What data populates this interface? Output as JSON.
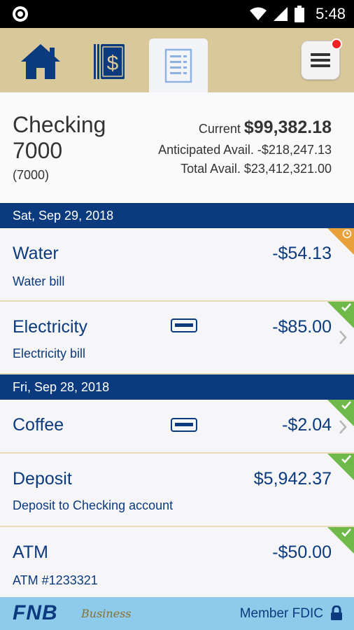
{
  "status_bar": {
    "time": "5:48"
  },
  "nav": {
    "home_icon": "home-icon",
    "accounts_icon": "dollar-cards-icon",
    "register_icon": "register-list-icon",
    "menu_icon": "hamburger-menu-icon"
  },
  "account": {
    "name": "Checking 7000",
    "number": "(7000)",
    "current_label": "Current",
    "current_value": "$99,382.18",
    "anticipated": "Anticipated Avail. -$218,247.13",
    "total": "Total Avail. $23,412,321.00"
  },
  "groups": [
    {
      "date": "Sat, Sep 29, 2018",
      "transactions": [
        {
          "title": "Water",
          "amount": "-$54.13",
          "subtitle": "Water bill",
          "status": "pending"
        },
        {
          "title": "Electricity",
          "amount": "-$85.00",
          "subtitle": "Electricity bill",
          "status": "cleared"
        }
      ]
    },
    {
      "date": "Fri, Sep 28, 2018",
      "transactions": [
        {
          "title": "Coffee",
          "amount": "-$2.04",
          "subtitle": "",
          "status": "cleared"
        },
        {
          "title": "Deposit",
          "amount": "$5,942.37",
          "subtitle": "Deposit to Checking account",
          "status": "cleared"
        },
        {
          "title": "ATM",
          "amount": "-$50.00",
          "subtitle": "ATM #1233321",
          "status": "cleared"
        }
      ]
    }
  ],
  "footer": {
    "brand": "FNB",
    "brand_sub": "Business",
    "member": "Member FDIC"
  },
  "colors": {
    "navy": "#0b3a7e",
    "tan": "#d9c99a",
    "cleared": "#6fb84a",
    "pending": "#e9a23b",
    "footer": "#8ecbea"
  }
}
